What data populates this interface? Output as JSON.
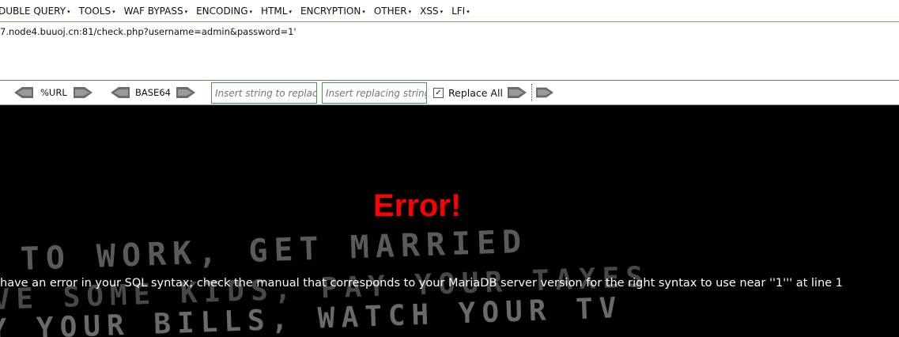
{
  "menu": {
    "items": [
      {
        "label": "DUBLE QUERY"
      },
      {
        "label": "TOOLS"
      },
      {
        "label": "WAF BYPASS"
      },
      {
        "label": "ENCODING"
      },
      {
        "label": "HTML"
      },
      {
        "label": "ENCRYPTION"
      },
      {
        "label": "OTHER"
      },
      {
        "label": "XSS"
      },
      {
        "label": "LFI"
      }
    ]
  },
  "url": {
    "value": "7.node4.buuoj.cn:81/check.php?username=admin&password=1'"
  },
  "toolbar": {
    "url_encode_label": "%URL",
    "base64_label": "BASE64",
    "replace_string_placeholder": "Insert string to replace",
    "replacing_string_placeholder": "Insert replacing string",
    "replace_all_label": "Replace All",
    "replace_all_checked": true
  },
  "page": {
    "error_title": "Error!",
    "error_message": "have an error in your SQL syntax; check the manual that corresponds to your MariaDB server version for the right syntax to use near ''1''' at line 1",
    "background_lines": [
      "TO WORK, GET MARRIED",
      "VE SOME KIDS, PAY YOUR TAXES",
      "Y YOUR BILLS, WATCH YOUR TV"
    ]
  },
  "colors": {
    "error_title": "#ff0000",
    "input_border": "#4a9a4a"
  }
}
